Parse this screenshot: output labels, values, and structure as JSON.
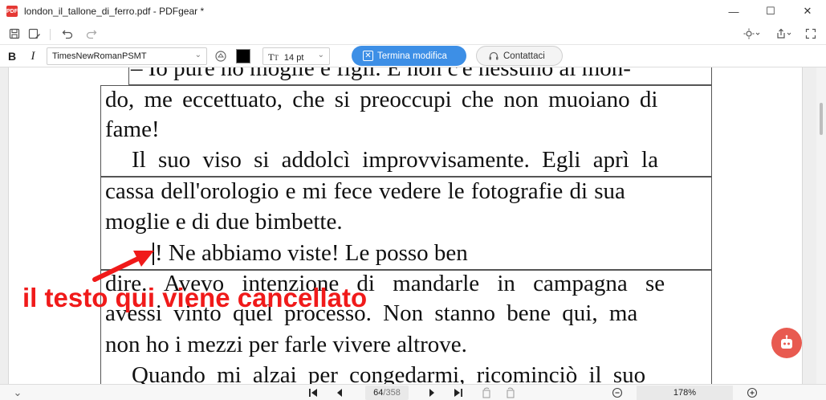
{
  "window": {
    "app_icon_text": "PDF",
    "title": "london_il_tallone_di_ferro.pdf - PDFgear *",
    "minimize": "—",
    "maximize": "☐",
    "close": "✕"
  },
  "toolbar": {
    "save_icon": "save-icon",
    "save_as_icon": "save-as-icon",
    "undo_icon": "undo-icon",
    "redo_icon": "redo-icon",
    "theme_icon": "sun-icon",
    "share_icon": "share-icon",
    "fullscreen_icon": "fullscreen-icon"
  },
  "format_bar": {
    "bold_label": "B",
    "italic_label": "I",
    "font_family": "TimesNewRomanPSMT",
    "font_size": "14 pt",
    "text_color": "#000000",
    "finish_label": "Termina modifica",
    "contact_label": "Contattaci",
    "accent_color": "#3d8fe6"
  },
  "document": {
    "lines": [
      "– Io pure ho moglie e figli. E non c'è nessuno al mon-",
      "do, me eccettuato, che si preoccupi che non muoiano di",
      "fame!",
      "Il suo viso si addolcì improvvisamente. Egli aprì la",
      "cassa dell'orologio e mi fece vedere le fotografie di sua",
      "moglie e di due bimbette.",
      "! Ne abbiamo viste! Le posso ben",
      "dire. Avevo intenzione di mandarle in campagna se",
      "avessi vinto quel processo. Non stanno bene qui, ma",
      "non ho i mezzi per farle vivere altrove.",
      "Quando mi alzai per congedarmi, ricominciò il suo"
    ]
  },
  "annotation": {
    "text": "il testo qui viene cancellato",
    "color": "#f01a1a"
  },
  "statusbar": {
    "current_page": "64",
    "total_pages": "/358",
    "zoom": "178%"
  }
}
